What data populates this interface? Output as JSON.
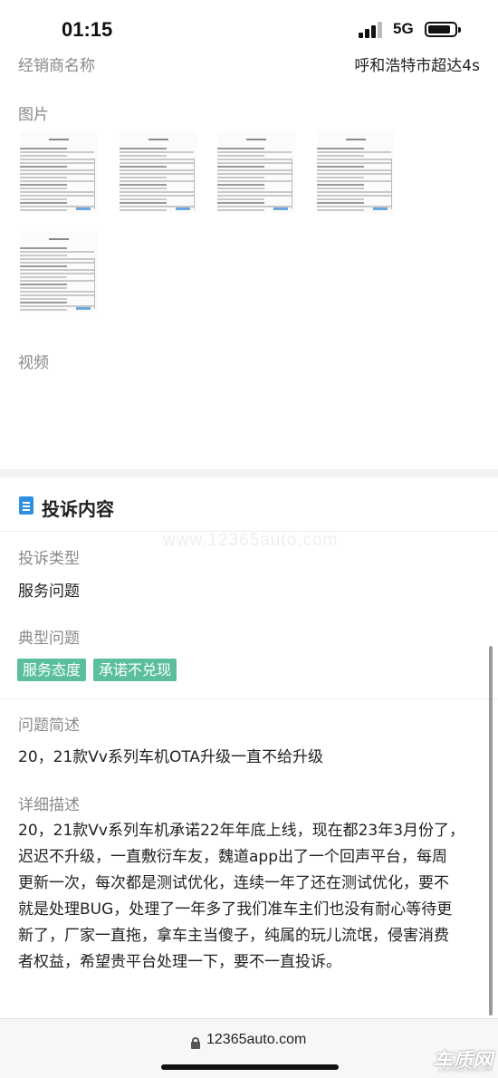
{
  "status_bar": {
    "time": "01:15",
    "network": "5G"
  },
  "dealer": {
    "label": "经销商名称",
    "value": "呼和浩特市超达4s"
  },
  "images": {
    "label": "图片",
    "count": 5
  },
  "video": {
    "label": "视频"
  },
  "complaint": {
    "section_title": "投诉内容",
    "watermark": "www.12365auto.com",
    "type_label": "投诉类型",
    "type_value": "服务问题",
    "typical_label": "典型问题",
    "tags": [
      "服务态度",
      "承诺不兑现"
    ],
    "summary_label": "问题简述",
    "summary_value": "20，21款Vv系列车机OTA升级一直不给升级",
    "detail_label": "详细描述",
    "detail_lines": [
      "20，21款Vv系列车机承诺22年年底上线，现在都23年3月份了，",
      "迟迟不升级，一直敷衍车友，魏道app出了一个回声平台，每周",
      "更新一次，每次都是测试优化，连续一年了还在测试优化，要不",
      "就是处理BUG，处理了一年多了我们准车主们也没有耐心等待更",
      "新了，厂家一直拖，拿车主当傻子，纯属的玩儿流氓，侵害消费",
      "者权益，希望贵平台处理一下，要不一直投诉。"
    ]
  },
  "browser": {
    "url": "12365auto.com"
  },
  "brand": {
    "logo_text": "车质网",
    "logo_url": "12365auto.com"
  }
}
